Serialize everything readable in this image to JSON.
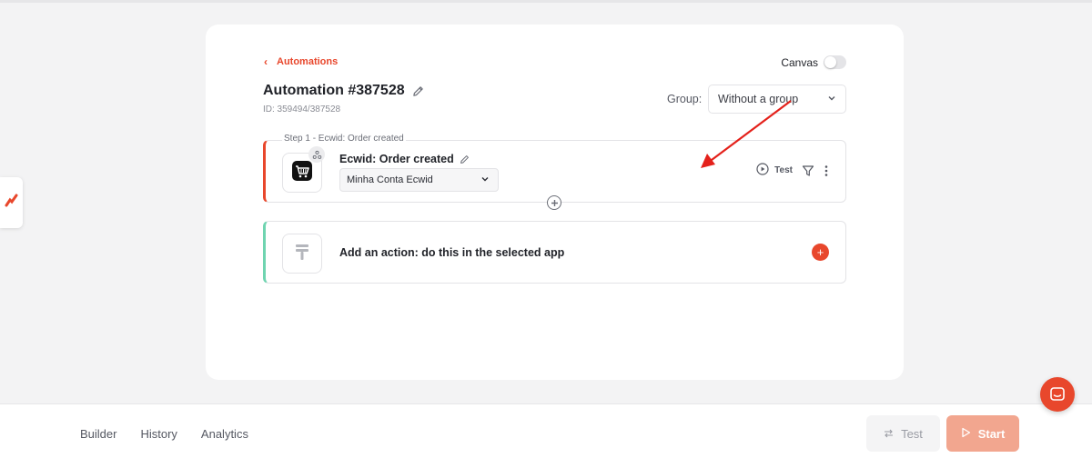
{
  "header": {
    "back_label": "Automations",
    "canvas_label": "Canvas",
    "title": "Automation #387528",
    "id_text": "ID: 359494/387528",
    "group_label": "Group:",
    "group_value": "Without a group"
  },
  "trigger": {
    "caption": "Step 1 - Ecwid: Order created",
    "name": "Ecwid: Order created",
    "account": "Minha Conta Ecwid",
    "test_label": "Test"
  },
  "action": {
    "label": "Add an action: do this in the selected app",
    "add_symbol": "+"
  },
  "footer": {
    "tabs": [
      "Builder",
      "History",
      "Analytics"
    ],
    "test_label": "Test",
    "start_label": "Start"
  },
  "colors": {
    "accent": "#e8472c",
    "action_accent": "#6fd4b0",
    "start_button": "#f2a68f",
    "annotation_arrow": "#e4211b"
  },
  "icons": {
    "back": "chevron-left-icon",
    "edit": "pencil-icon",
    "dropdown": "chevron-down-icon",
    "trigger_app": "shopping-cart-icon",
    "webhook": "webhook-icon",
    "test": "play-circle-icon",
    "filter": "filter-icon",
    "more": "vertical-dots-icon",
    "add_step": "plus-circle-icon",
    "action_app": "placeholder-app-icon",
    "swap": "swap-arrows-icon",
    "start": "play-icon",
    "chat": "chat-icon",
    "sidebar": "logo-slash-icon"
  }
}
